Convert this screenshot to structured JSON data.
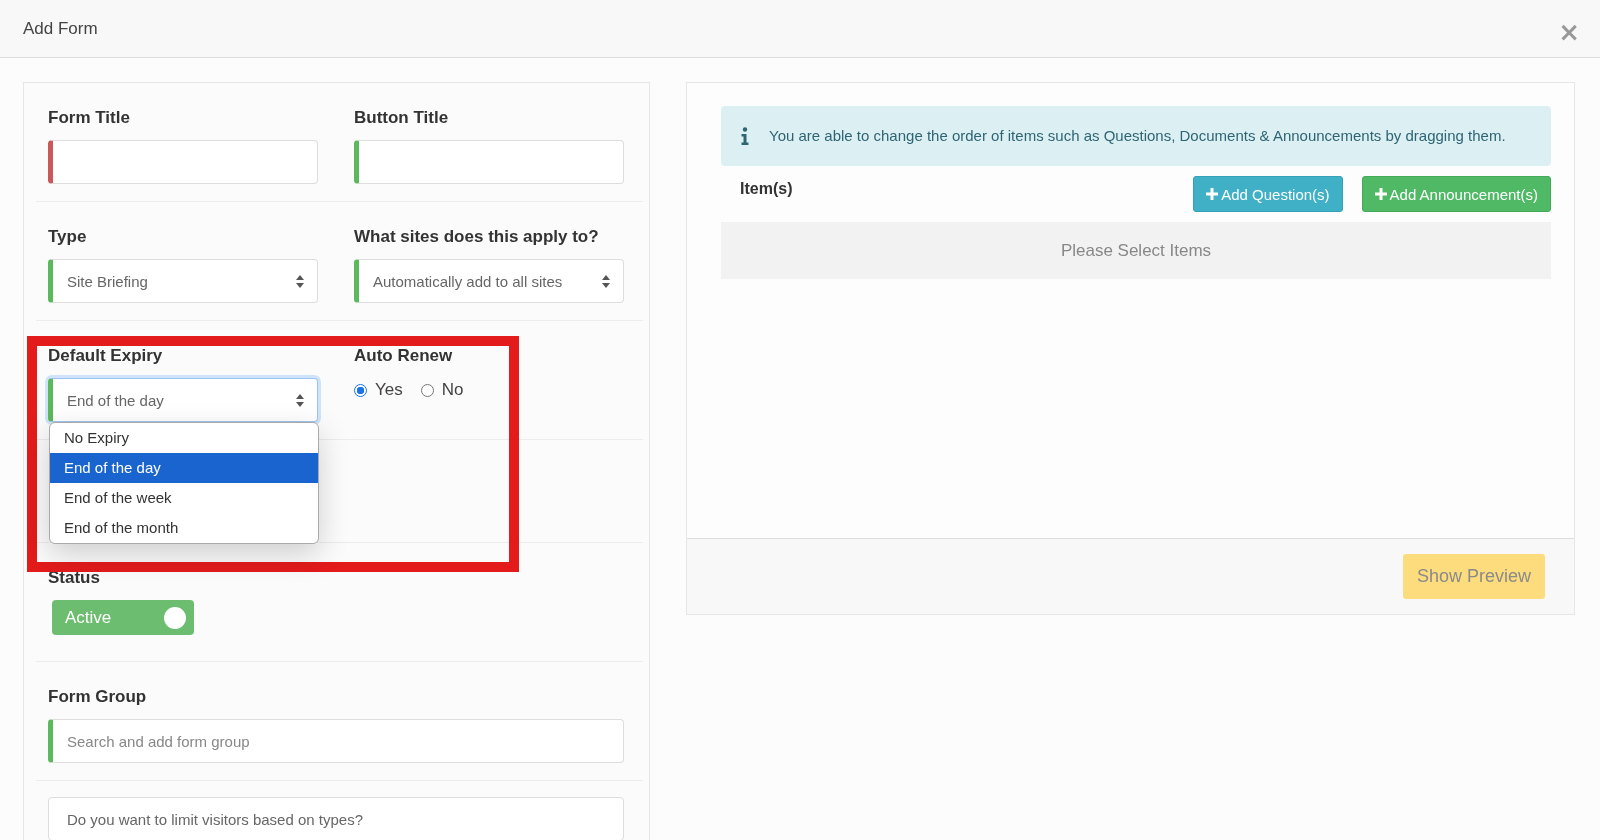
{
  "dialog": {
    "title": "Add Form",
    "close": "×"
  },
  "form": {
    "form_title": {
      "label": "Form Title",
      "valid": false
    },
    "button_title": {
      "label": "Button Title",
      "valid": true
    },
    "type": {
      "label": "Type",
      "value": "Site Briefing",
      "valid": true
    },
    "sites": {
      "label": "What sites does this apply to?",
      "value": "Automatically add to all sites",
      "valid": true
    },
    "default_expiry": {
      "label": "Default Expiry",
      "value": "End of the day",
      "valid": true,
      "focused": true,
      "expanded": true,
      "options": [
        {
          "label": "No Expiry",
          "selected": false
        },
        {
          "label": "End of the day",
          "selected": true
        },
        {
          "label": "End of the week",
          "selected": false
        },
        {
          "label": "End of the month",
          "selected": false
        }
      ]
    },
    "auto_renew": {
      "label": "Auto Renew",
      "options": [
        {
          "label": "Yes",
          "selected": true
        },
        {
          "label": "No",
          "selected": false
        }
      ]
    },
    "status": {
      "label": "Status",
      "toggle": {
        "label": "Active",
        "on": true
      }
    },
    "form_group": {
      "label": "Form Group",
      "placeholder": "Search and add form group",
      "valid": true
    },
    "visitor_types": {
      "value": "Do you want to limit visitors based on types?"
    }
  },
  "items_panel": {
    "notice": "You are able to change the order of items such as Questions, Documents & Announcements by dragging them.",
    "items_label": "Item(s)",
    "buttons": [
      {
        "label": "Add Question(s)",
        "kind": "info"
      },
      {
        "label": "Add Announcement(s)",
        "kind": "success"
      }
    ],
    "empty_text": "Please Select Items",
    "preview_button": {
      "label": "Show Preview",
      "disabled": true
    }
  }
}
